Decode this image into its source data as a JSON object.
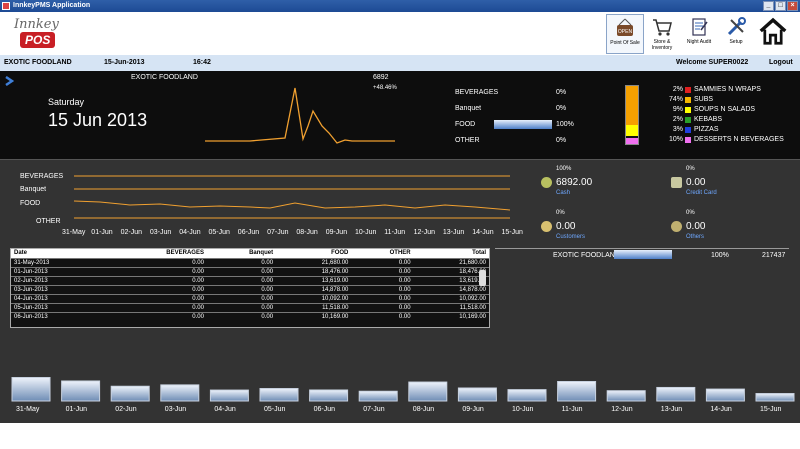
{
  "window": {
    "title": "InnkeyPMS Application"
  },
  "logo": {
    "top": "Innkey",
    "bottom": "POS"
  },
  "nav": [
    {
      "label": "Point Of Sale",
      "icon": "open-sign-icon"
    },
    {
      "label": "Store & Inventory",
      "icon": "cart-icon"
    },
    {
      "label": "Night Audit",
      "icon": "clipboard-icon"
    },
    {
      "label": "Setup",
      "icon": "tools-icon"
    },
    {
      "label": "",
      "icon": "home-icon"
    }
  ],
  "info": {
    "outlet": "EXOTIC FOODLAND",
    "date": "15-Jun-2013",
    "time": "16:42",
    "welcome": "Welcome SUPER0022",
    "logout": "Logout"
  },
  "summary": {
    "outlet": "EXOTIC FOODLAND",
    "weekday": "Saturday",
    "date": "15 Jun 2013",
    "total": "6892",
    "change": "+48.46%",
    "categories": [
      {
        "name": "BEVERAGES",
        "pct": "0%",
        "fill": 0
      },
      {
        "name": "Banquet",
        "pct": "0%",
        "fill": 0
      },
      {
        "name": "FOOD",
        "pct": "100%",
        "fill": 1
      },
      {
        "name": "OTHER",
        "pct": "0%",
        "fill": 0
      }
    ],
    "legend": [
      {
        "pct": "2%",
        "name": "SAMMIES N WRAPS",
        "color": "#e02020"
      },
      {
        "pct": "74%",
        "name": "SUBS",
        "color": "#f5b800"
      },
      {
        "pct": "9%",
        "name": "SOUPS N SALADS",
        "color": "#ffff00"
      },
      {
        "pct": "2%",
        "name": "KEBABS",
        "color": "#2aa02a"
      },
      {
        "pct": "3%",
        "name": "PIZZAS",
        "color": "#2040e0"
      },
      {
        "pct": "10%",
        "name": "DESSERTS N BEVERAGES",
        "color": "#f070f0"
      }
    ]
  },
  "trend": {
    "rows": [
      "BEVERAGES",
      "Banquet",
      "FOOD",
      "OTHER"
    ],
    "dates": [
      "31-May",
      "01-Jun",
      "02-Jun",
      "03-Jun",
      "04-Jun",
      "05-Jun",
      "06-Jun",
      "07-Jun",
      "08-Jun",
      "09-Jun",
      "10-Jun",
      "11-Jun",
      "12-Jun",
      "13-Jun",
      "14-Jun",
      "15-Jun"
    ]
  },
  "payments": [
    {
      "pct": "100%",
      "amount": "6892.00",
      "label": "Cash",
      "icon": "coin-icon"
    },
    {
      "pct": "0%",
      "amount": "0.00",
      "label": "Credit Card",
      "icon": "credit-card-icon"
    },
    {
      "pct": "0%",
      "amount": "0.00",
      "label": "Customers",
      "icon": "customer-icon"
    },
    {
      "pct": "0%",
      "amount": "0.00",
      "label": "Others",
      "icon": "others-icon"
    }
  ],
  "outlet_share": {
    "name": "EXOTIC FOODLAND",
    "pct": "100%",
    "value": "217437",
    "fill": 1
  },
  "table": {
    "headers": [
      "Date",
      "BEVERAGES",
      "Banquet",
      "FOOD",
      "OTHER",
      "Total"
    ],
    "rows": [
      [
        "31-May-2013",
        "0.00",
        "0.00",
        "21,680.00",
        "0.00",
        "21,680.00"
      ],
      [
        "01-Jun-2013",
        "0.00",
        "0.00",
        "18,476.00",
        "0.00",
        "18,476.00"
      ],
      [
        "02-Jun-2013",
        "0.00",
        "0.00",
        "13,619.00",
        "0.00",
        "13,619.00"
      ],
      [
        "03-Jun-2013",
        "0.00",
        "0.00",
        "14,878.00",
        "0.00",
        "14,878.00"
      ],
      [
        "04-Jun-2013",
        "0.00",
        "0.00",
        "10,092.00",
        "0.00",
        "10,092.00"
      ],
      [
        "05-Jun-2013",
        "0.00",
        "0.00",
        "11,518.00",
        "0.00",
        "11,518.00"
      ],
      [
        "06-Jun-2013",
        "0.00",
        "0.00",
        "10,169.00",
        "0.00",
        "10,169.00"
      ]
    ]
  },
  "chart_data": {
    "type": "bar",
    "categories": [
      "31-May",
      "01-Jun",
      "02-Jun",
      "03-Jun",
      "04-Jun",
      "05-Jun",
      "06-Jun",
      "07-Jun",
      "08-Jun",
      "09-Jun",
      "10-Jun",
      "11-Jun",
      "12-Jun",
      "13-Jun",
      "14-Jun",
      "15-Jun"
    ],
    "values": [
      21680,
      18476,
      13619,
      14878,
      10092,
      11518,
      10169,
      9000,
      17500,
      12000,
      10500,
      18000,
      9500,
      12500,
      11000,
      6892
    ],
    "ylim": [
      0,
      24000
    ]
  }
}
